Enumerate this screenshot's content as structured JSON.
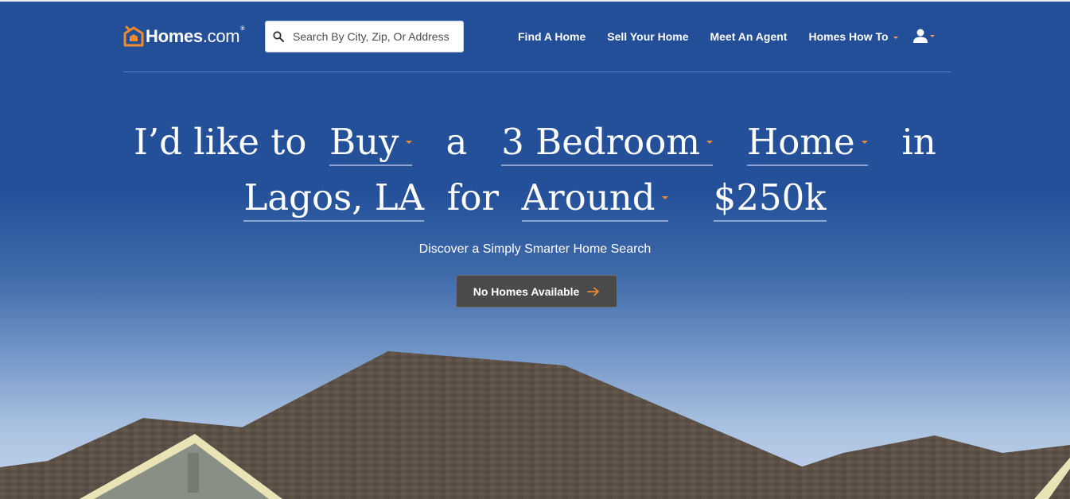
{
  "brand": {
    "name": "Homes",
    "dotcom": ".com",
    "tm": "®",
    "accent_color": "#f28a2e",
    "background_color": "#24509a"
  },
  "search": {
    "placeholder": "Search By City, Zip, Or Address",
    "value": ""
  },
  "nav": {
    "items": [
      {
        "label": "Find A Home",
        "has_dropdown": false
      },
      {
        "label": "Sell Your Home",
        "has_dropdown": false
      },
      {
        "label": "Meet An Agent",
        "has_dropdown": false
      },
      {
        "label": "Homes How To",
        "has_dropdown": true
      }
    ],
    "user_icon": "user-icon"
  },
  "hero": {
    "prefix": "I’d like to",
    "action": "Buy",
    "connector_a": "a",
    "bedrooms": "3 Bedroom",
    "property_type": "Home",
    "connector_in": "in",
    "location": "Lagos, LA",
    "connector_for": "for",
    "price_qualifier": "Around",
    "price": "$250k"
  },
  "tagline": "Discover a Simply Smarter Home Search",
  "cta": {
    "label": "No Homes Available",
    "icon": "arrow-right-icon"
  }
}
